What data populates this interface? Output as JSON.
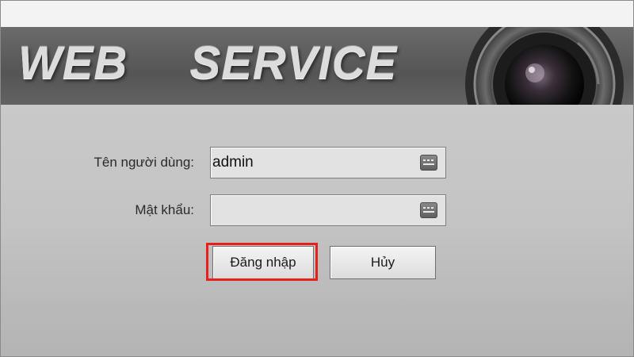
{
  "banner": {
    "title": "WEB  SERVICE"
  },
  "form": {
    "username_label": "Tên người dùng:",
    "username_value": "admin",
    "password_label": "Mật khẩu:",
    "password_value": ""
  },
  "buttons": {
    "login": "Đăng nhập",
    "cancel": "Hủy"
  },
  "icons": {
    "keyboard": "keyboard-icon",
    "camera": "camera-lens-icon"
  },
  "colors": {
    "highlight": "#e8201c",
    "banner": "#5e5e5e",
    "panel": "#c6c6c6"
  }
}
